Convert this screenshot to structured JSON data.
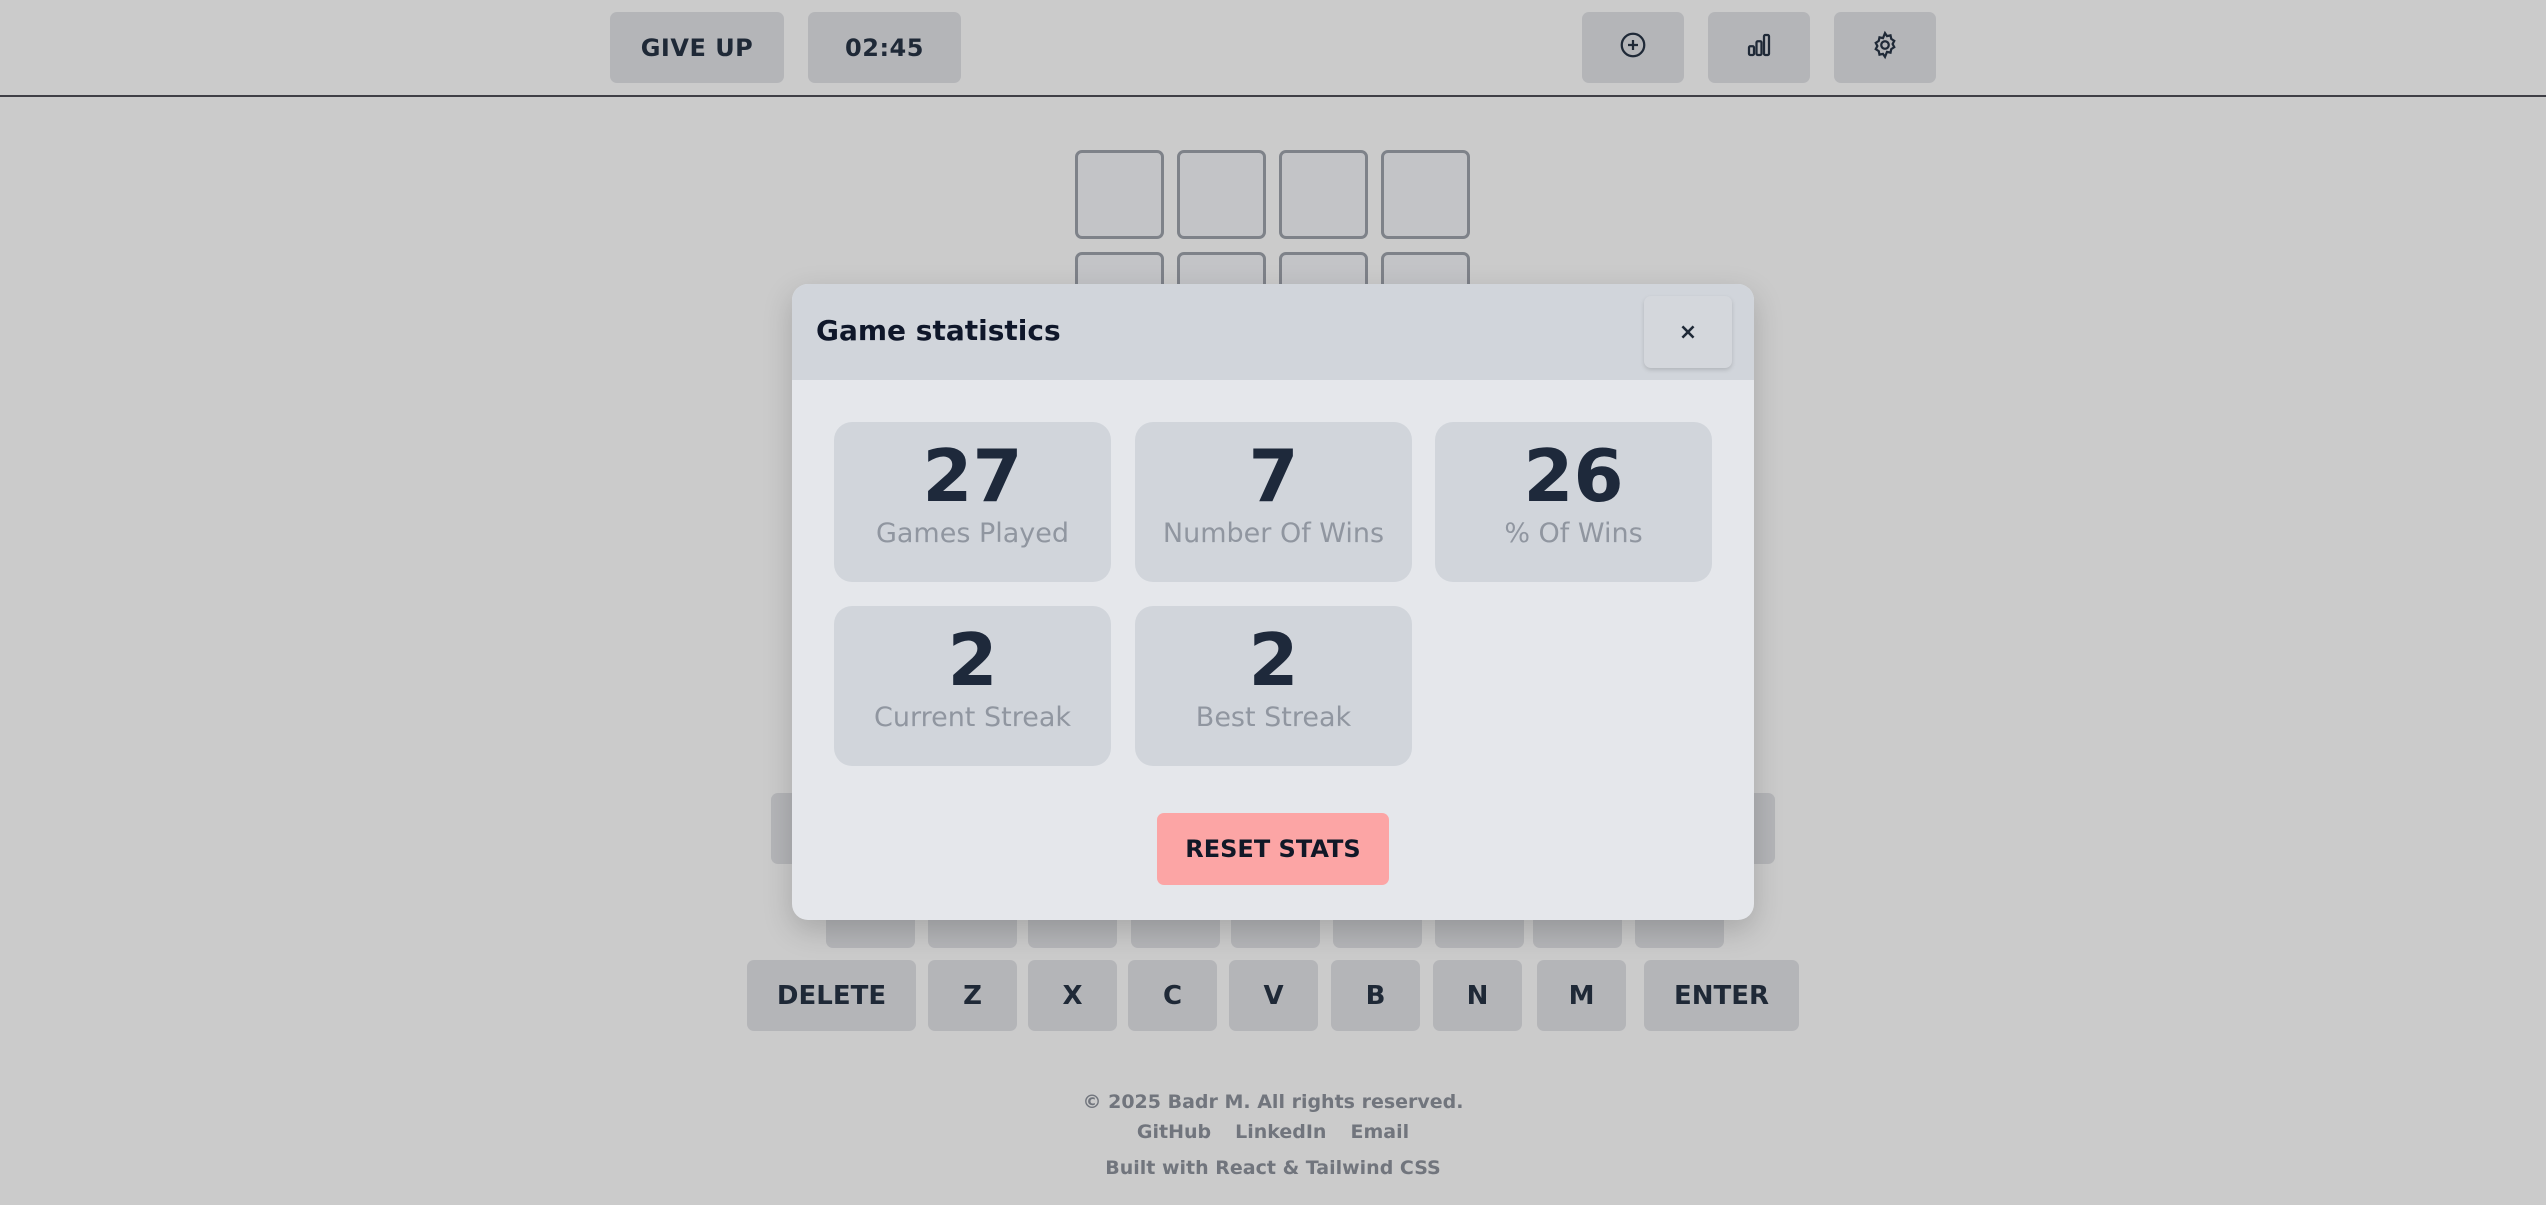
{
  "header": {
    "give_up_label": "GIVE UP",
    "timer": "02:45",
    "icons": [
      "plus-circle-icon",
      "bar-chart-icon",
      "gear-icon"
    ]
  },
  "keyboard": {
    "bottom_row": [
      "DELETE",
      "Z",
      "X",
      "C",
      "V",
      "B",
      "N",
      "M",
      "ENTER"
    ]
  },
  "modal": {
    "title": "Game statistics",
    "close_label": "×",
    "stats": [
      {
        "value": "27",
        "label": "Games Played"
      },
      {
        "value": "7",
        "label": "Number Of Wins"
      },
      {
        "value": "26",
        "label": "% Of Wins"
      },
      {
        "value": "2",
        "label": "Current Streak"
      },
      {
        "value": "2",
        "label": "Best Streak"
      }
    ],
    "reset_label": "RESET STATS"
  },
  "footer": {
    "copyright": "© 2025 Badr M. All rights reserved.",
    "links": [
      "GitHub",
      "LinkedIn",
      "Email"
    ],
    "built_with": "Built with React & Tailwind CSS"
  },
  "colors": {
    "background": "#cbcbcb",
    "modal_bg": "#e5e7eb",
    "stat_card": "#d1d5db",
    "reset_button": "#fca5a5"
  }
}
